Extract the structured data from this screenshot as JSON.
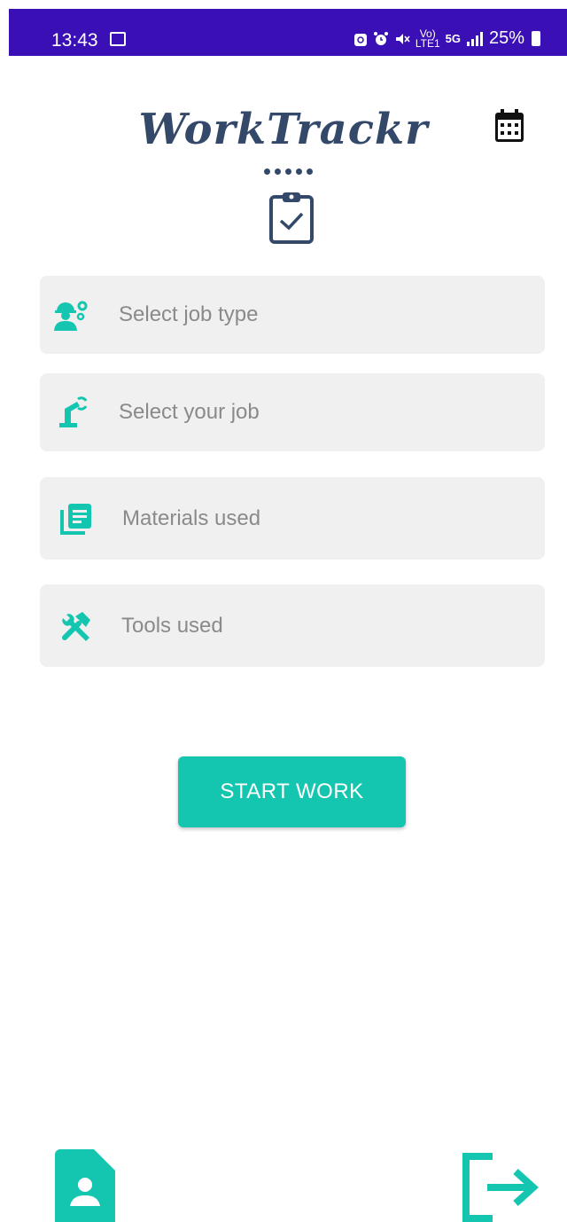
{
  "status_bar": {
    "time": "13:43",
    "network_top": "Vo)",
    "network_bottom": "LTE1",
    "generation": "5G",
    "battery": "25%"
  },
  "app": {
    "title": "WorkTrackr",
    "accent_color": "#14c6b0",
    "title_color": "#34496a"
  },
  "form": {
    "job_type_placeholder": "Select job type",
    "job_placeholder": "Select your job",
    "materials_placeholder": "Materials used",
    "tools_placeholder": "Tools used"
  },
  "actions": {
    "start_label": "START WORK"
  },
  "icons": {
    "calendar": "calendar-icon",
    "clipboard": "clipboard-check-icon",
    "worker": "worker-gears-icon",
    "robot_arm": "robot-arm-icon",
    "materials": "library-books-icon",
    "tools": "tools-icon",
    "profile": "contact-file-icon",
    "logout": "logout-icon"
  }
}
